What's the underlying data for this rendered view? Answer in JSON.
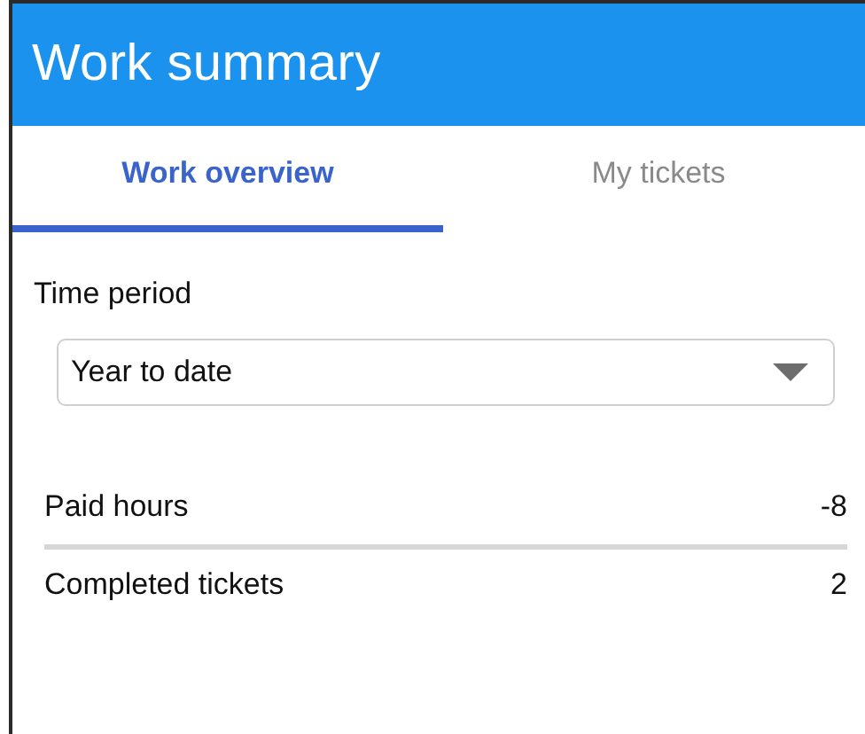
{
  "header": {
    "title": "Work summary"
  },
  "tabs": [
    {
      "label": "Work overview",
      "selected": true
    },
    {
      "label": "My tickets",
      "selected": false
    }
  ],
  "filter": {
    "label": "Time period",
    "value": "Year to date"
  },
  "stats": [
    {
      "label": "Paid hours",
      "value": "-8"
    },
    {
      "label": "Completed tickets",
      "value": "2"
    }
  ]
}
